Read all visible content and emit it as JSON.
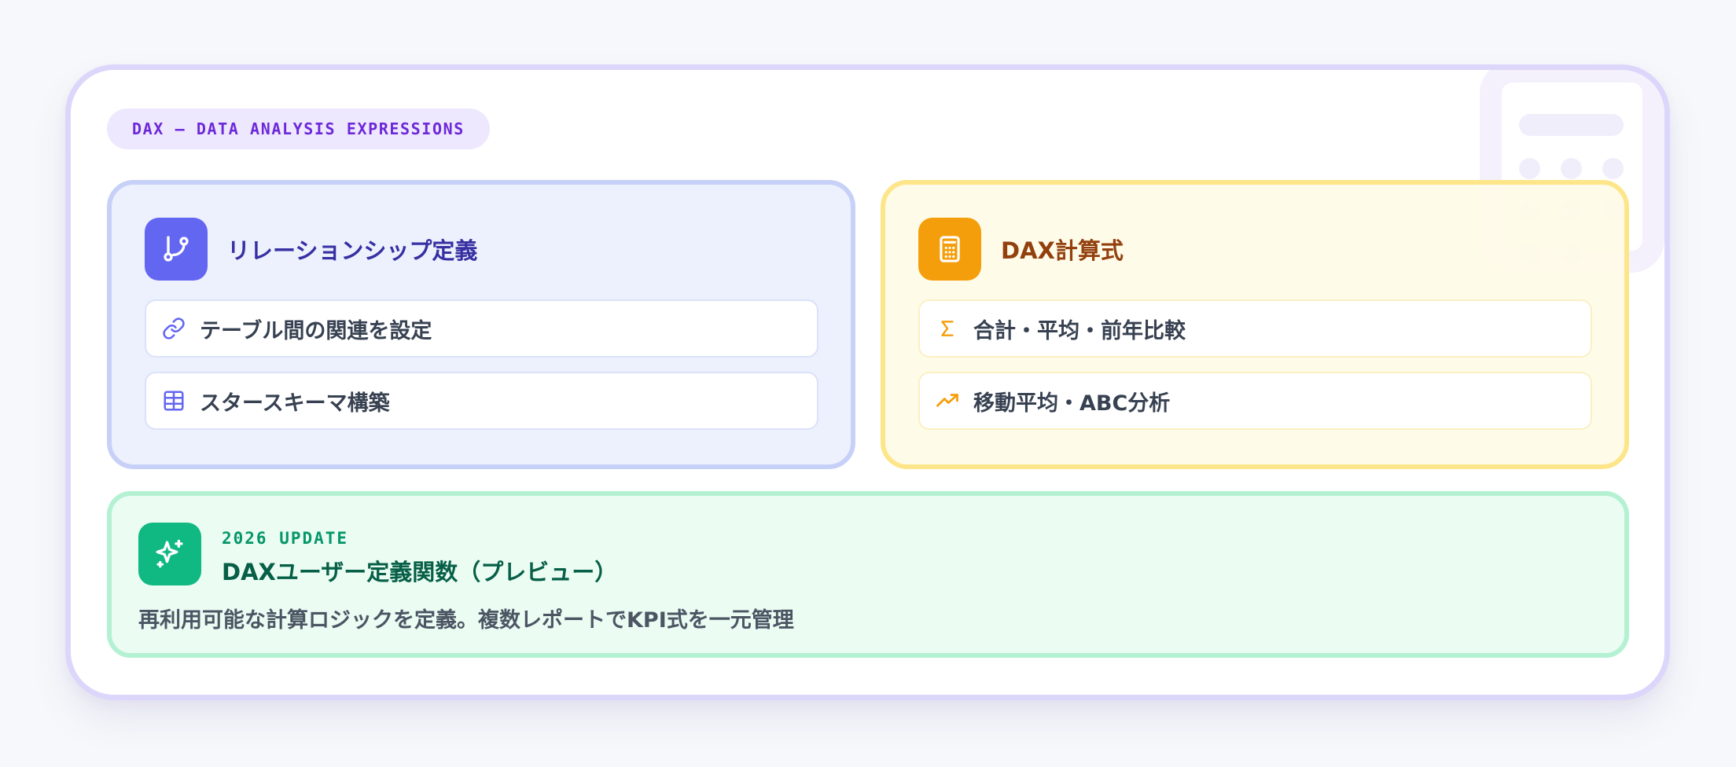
{
  "tag": {
    "label": "DAX — DATA ANALYSIS EXPRESSIONS"
  },
  "cards": {
    "relationship": {
      "title": "リレーションシップ定義",
      "icon": "git-branch-icon",
      "items": [
        {
          "label": "テーブル間の関連を設定",
          "icon": "link-icon"
        },
        {
          "label": "スタースキーマ構築",
          "icon": "table-icon"
        }
      ]
    },
    "dax": {
      "title": "DAX計算式",
      "icon": "calculator-icon",
      "items": [
        {
          "label": "合計・平均・前年比較",
          "icon": "sigma-icon"
        },
        {
          "label": "移動平均・ABC分析",
          "icon": "trending-up-icon"
        }
      ]
    }
  },
  "update": {
    "icon": "sparkles-icon",
    "kicker": "2026 UPDATE",
    "title": "DAXユーザー定義関数（プレビュー）",
    "description": "再利用可能な計算ロジックを定義。複数レポートでKPI式を一元管理"
  },
  "colors": {
    "accent_purple": "#6d28d9",
    "indigo": "#6366f1",
    "amber": "#f59e0b",
    "green": "#10b981"
  }
}
